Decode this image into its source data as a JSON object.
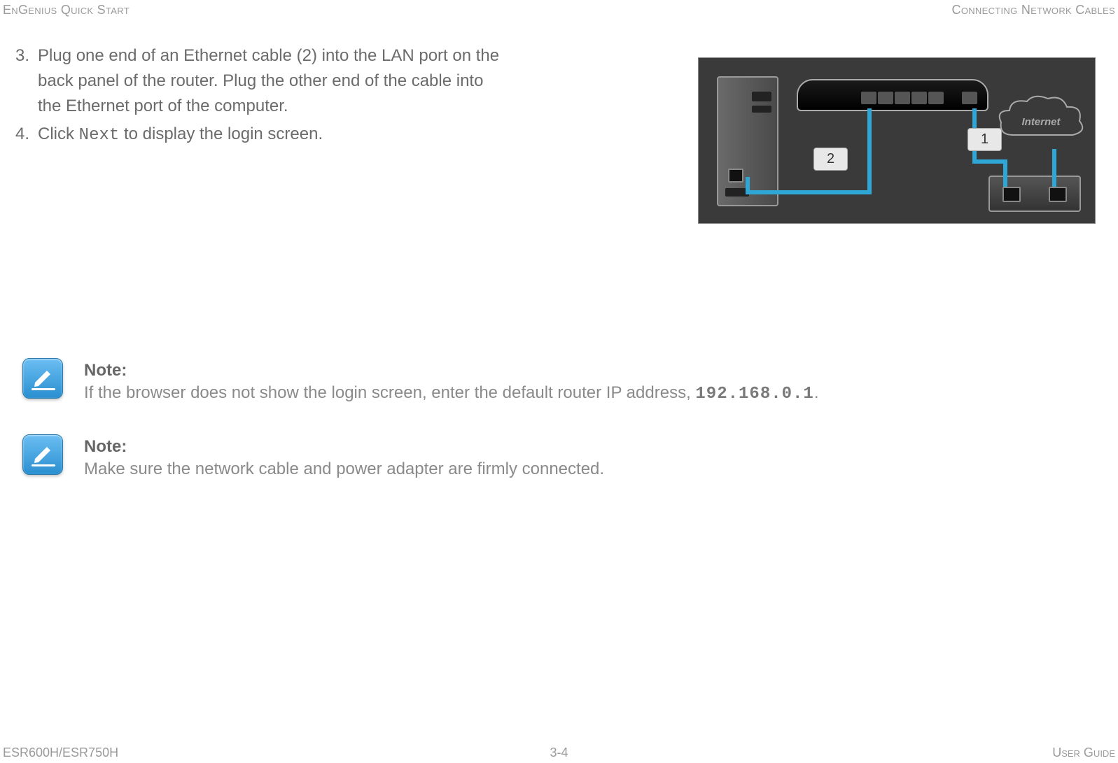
{
  "header": {
    "left": "EnGenius Quick Start",
    "right": "Connecting Network Cables"
  },
  "steps": [
    {
      "num": "3.",
      "text": "Plug one end of an Ethernet cable (2) into the LAN port on the back panel of the router. Plug the other end of the cable into the Ethernet port of the computer."
    },
    {
      "num": "4.",
      "prefix": "Click ",
      "mono": "Next",
      "suffix": " to display the login screen."
    }
  ],
  "diagram": {
    "label1": "1",
    "label2": "2",
    "cloud": "Internet"
  },
  "notes": [
    {
      "title": "Note:",
      "prefix": "If the browser does not show the login screen, enter the default router IP address, ",
      "mono": "192.168.0.1",
      "suffix": "."
    },
    {
      "title": "Note:",
      "text": "Make sure the network cable and power adapter are firmly connected."
    }
  ],
  "footer": {
    "left": "ESR600H/ESR750H",
    "center": "3-4",
    "right": "User Guide"
  }
}
